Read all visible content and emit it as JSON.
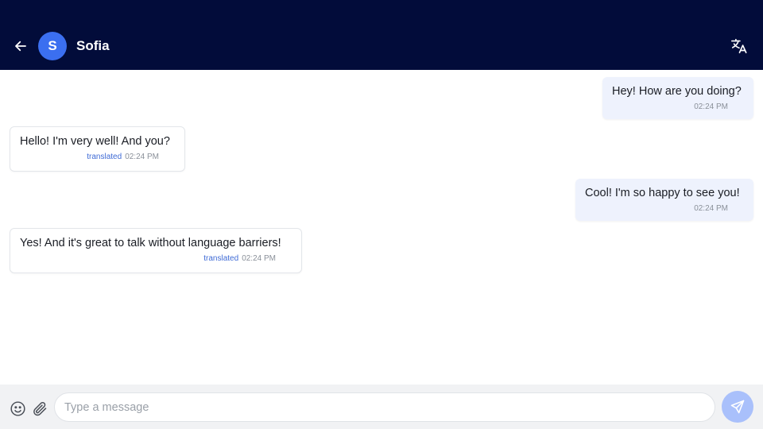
{
  "header": {
    "contact_name": "Sofia",
    "avatar_initial": "S",
    "back_icon": "arrow-left-icon",
    "translate_icon": "translate-icon"
  },
  "messages": [
    {
      "direction": "sent",
      "text": "Hey! How are you doing?",
      "time": "02:24 PM",
      "flag": ""
    },
    {
      "direction": "received",
      "text": "Hello! I'm very well! And you?",
      "time": "02:24 PM",
      "flag": "translated"
    },
    {
      "direction": "sent",
      "text": "Cool! I'm so happy to see you!",
      "time": "02:24 PM",
      "flag": ""
    },
    {
      "direction": "received",
      "text": "Yes! And it's great to talk without language barriers!",
      "time": "02:24 PM",
      "flag": "translated"
    }
  ],
  "composer": {
    "placeholder": "Type a message",
    "value": "",
    "emoji_icon": "smiley-icon",
    "attach_icon": "paperclip-icon",
    "send_icon": "send-icon"
  },
  "colors": {
    "header_bg": "#020c3a",
    "avatar_bg": "#3b6ff0",
    "sent_bubble": "#eef2fd",
    "translated_label": "#3f6bd6",
    "send_button": "#a9c0fb"
  }
}
